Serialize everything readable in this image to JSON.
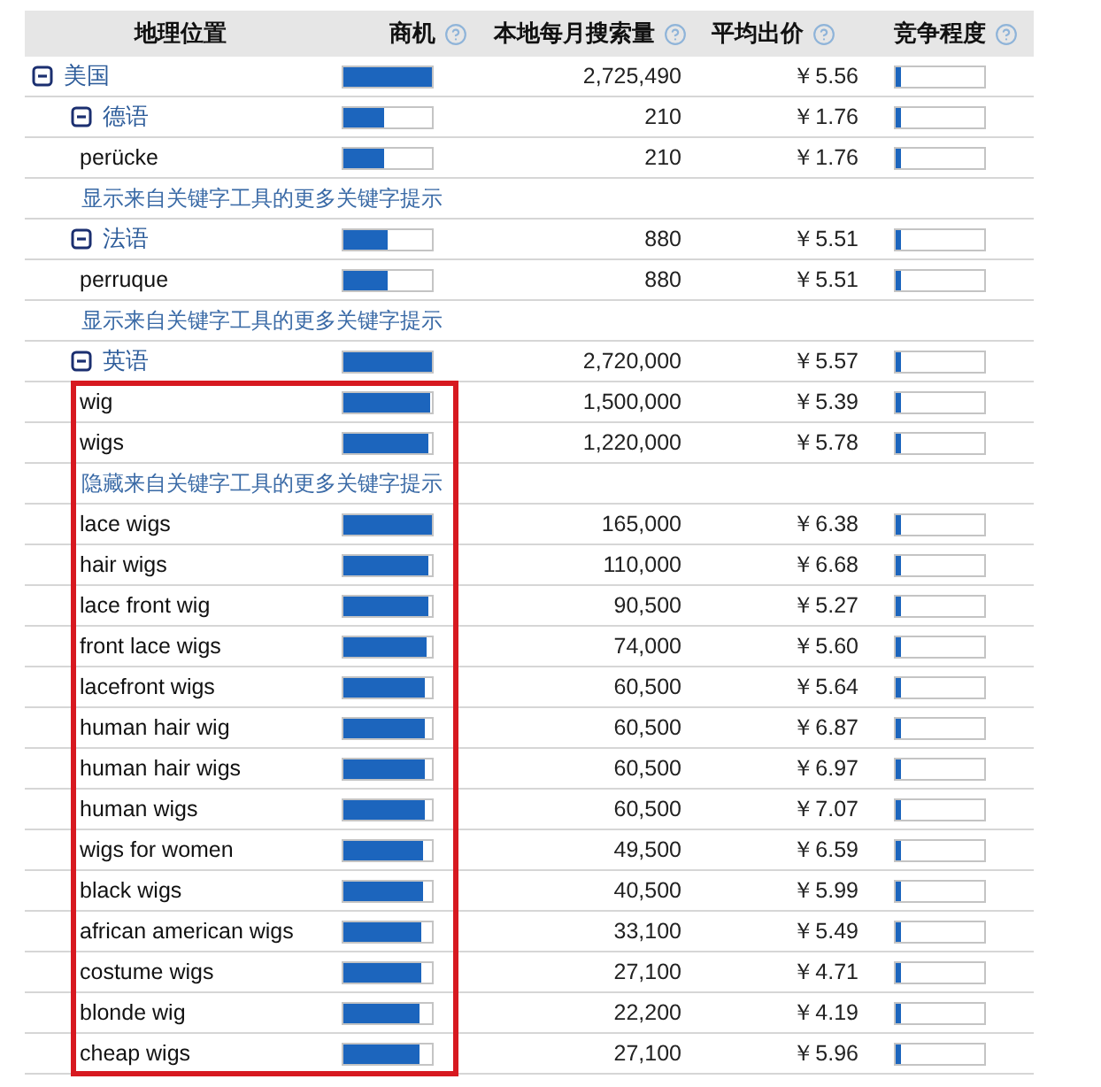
{
  "table": {
    "columns": [
      {
        "label": "地理位置",
        "help": false
      },
      {
        "label": "商机",
        "help": true
      },
      {
        "label": "本地每月搜索量",
        "help": true
      },
      {
        "label": "平均出价",
        "help": true
      },
      {
        "label": "竞争程度",
        "help": true
      }
    ],
    "rows": [
      {
        "kind": "group",
        "label": "美国",
        "expanded": true,
        "opportunity": {
          "level": 1.0
        },
        "volume": "2,725,490",
        "price": "￥5.56",
        "competition": {
          "level": 0.06
        },
        "highlighted": false,
        "children": [
          {
            "kind": "group",
            "label": "德语",
            "expanded": true,
            "opportunity": {
              "level": 0.45
            },
            "volume": "210",
            "price": "￥1.76",
            "competition": {
              "level": 0.06
            },
            "highlighted": false,
            "children": [
              {
                "kind": "keyword",
                "label": "perücke",
                "opportunity": {
                  "level": 0.45
                },
                "volume": "210",
                "price": "￥1.76",
                "competition": {
                  "level": 0.06
                },
                "highlighted": false
              },
              {
                "kind": "link",
                "label": "显示来自关键字工具的更多关键字提示",
                "highlighted": false
              }
            ]
          },
          {
            "kind": "group",
            "label": "法语",
            "expanded": true,
            "opportunity": {
              "level": 0.5
            },
            "volume": "880",
            "price": "￥5.51",
            "competition": {
              "level": 0.06
            },
            "highlighted": false,
            "children": [
              {
                "kind": "keyword",
                "label": "perruque",
                "opportunity": {
                  "level": 0.5
                },
                "volume": "880",
                "price": "￥5.51",
                "competition": {
                  "level": 0.06
                },
                "highlighted": false
              },
              {
                "kind": "link",
                "label": "显示来自关键字工具的更多关键字提示",
                "highlighted": false
              }
            ]
          },
          {
            "kind": "group",
            "label": "英语",
            "expanded": true,
            "opportunity": {
              "level": 1.0
            },
            "volume": "2,720,000",
            "price": "￥5.57",
            "competition": {
              "level": 0.06
            },
            "highlighted": false,
            "children": [
              {
                "kind": "keyword",
                "label": "wig",
                "opportunity": {
                  "level": 0.97
                },
                "volume": "1,500,000",
                "price": "￥5.39",
                "competition": {
                  "level": 0.06
                },
                "highlighted": true
              },
              {
                "kind": "keyword",
                "label": "wigs",
                "opportunity": {
                  "level": 0.95
                },
                "volume": "1,220,000",
                "price": "￥5.78",
                "competition": {
                  "level": 0.06
                },
                "highlighted": true
              },
              {
                "kind": "link",
                "label": "隐藏来自关键字工具的更多关键字提示",
                "highlighted": true
              },
              {
                "kind": "keyword",
                "label": "lace wigs",
                "opportunity": {
                  "level": 1.0
                },
                "volume": "165,000",
                "price": "￥6.38",
                "competition": {
                  "level": 0.06
                },
                "highlighted": true
              },
              {
                "kind": "keyword",
                "label": "hair wigs",
                "opportunity": {
                  "level": 0.95
                },
                "volume": "110,000",
                "price": "￥6.68",
                "competition": {
                  "level": 0.06
                },
                "highlighted": true
              },
              {
                "kind": "keyword",
                "label": "lace front wig",
                "opportunity": {
                  "level": 0.95
                },
                "volume": "90,500",
                "price": "￥5.27",
                "competition": {
                  "level": 0.06
                },
                "highlighted": true
              },
              {
                "kind": "keyword",
                "label": "front lace wigs",
                "opportunity": {
                  "level": 0.93
                },
                "volume": "74,000",
                "price": "￥5.60",
                "competition": {
                  "level": 0.06
                },
                "highlighted": true
              },
              {
                "kind": "keyword",
                "label": "lacefront wigs",
                "opportunity": {
                  "level": 0.91
                },
                "volume": "60,500",
                "price": "￥5.64",
                "competition": {
                  "level": 0.06
                },
                "highlighted": true
              },
              {
                "kind": "keyword",
                "label": "human hair wig",
                "opportunity": {
                  "level": 0.91
                },
                "volume": "60,500",
                "price": "￥6.87",
                "competition": {
                  "level": 0.06
                },
                "highlighted": true
              },
              {
                "kind": "keyword",
                "label": "human hair wigs",
                "opportunity": {
                  "level": 0.91
                },
                "volume": "60,500",
                "price": "￥6.97",
                "competition": {
                  "level": 0.06
                },
                "highlighted": true
              },
              {
                "kind": "keyword",
                "label": "human wigs",
                "opportunity": {
                  "level": 0.91
                },
                "volume": "60,500",
                "price": "￥7.07",
                "competition": {
                  "level": 0.06
                },
                "highlighted": true
              },
              {
                "kind": "keyword",
                "label": "wigs for women",
                "opportunity": {
                  "level": 0.89
                },
                "volume": "49,500",
                "price": "￥6.59",
                "competition": {
                  "level": 0.06
                },
                "highlighted": true
              },
              {
                "kind": "keyword",
                "label": "black wigs",
                "opportunity": {
                  "level": 0.89
                },
                "volume": "40,500",
                "price": "￥5.99",
                "competition": {
                  "level": 0.06
                },
                "highlighted": true
              },
              {
                "kind": "keyword",
                "label": "african american wigs",
                "opportunity": {
                  "level": 0.87
                },
                "volume": "33,100",
                "price": "￥5.49",
                "competition": {
                  "level": 0.06
                },
                "highlighted": true
              },
              {
                "kind": "keyword",
                "label": "costume wigs",
                "opportunity": {
                  "level": 0.87
                },
                "volume": "27,100",
                "price": "￥4.71",
                "competition": {
                  "level": 0.06
                },
                "highlighted": true
              },
              {
                "kind": "keyword",
                "label": "blonde wig",
                "opportunity": {
                  "level": 0.85
                },
                "volume": "22,200",
                "price": "￥4.19",
                "competition": {
                  "level": 0.06
                },
                "highlighted": true
              },
              {
                "kind": "keyword",
                "label": "cheap wigs",
                "opportunity": {
                  "level": 0.85
                },
                "volume": "27,100",
                "price": "￥5.96",
                "competition": {
                  "level": 0.06
                },
                "highlighted": true
              }
            ]
          }
        ]
      }
    ]
  }
}
